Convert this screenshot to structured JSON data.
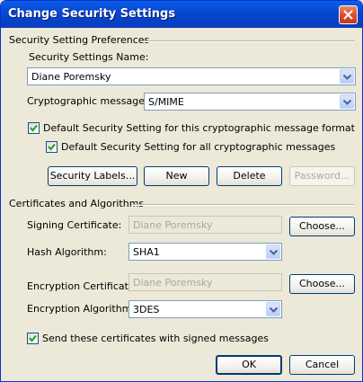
{
  "window": {
    "title": "Change Security Settings"
  },
  "preferences": {
    "section_label": "Security Setting Preferences",
    "name_label": "Security Settings Name:",
    "name_value": "Diane Poremsky",
    "crypto_label": "Cryptographic message",
    "crypto_value": "S/MIME",
    "default_format_label": "Default Security Setting for this cryptographic message format",
    "default_format_checked": true,
    "default_all_label": "Default Security Setting for all cryptographic messages",
    "default_all_checked": true,
    "buttons": {
      "security_labels": "Security Labels...",
      "new": "New",
      "delete": "Delete",
      "password": "Password..."
    }
  },
  "certificates": {
    "section_label": "Certificates and Algorithms",
    "signing_label": "Signing Certificate:",
    "signing_value": "Diane Poremsky",
    "signing_choose": "Choose...",
    "hash_label": "Hash Algorithm:",
    "hash_value": "SHA1",
    "encryption_label": "Encryption Certificate:",
    "encryption_value": "Diane Poremsky",
    "encryption_choose": "Choose...",
    "enc_alg_label": "Encryption Algorithm:",
    "enc_alg_value": "3DES",
    "send_certs_label": "Send these certificates with signed messages",
    "send_certs_checked": true
  },
  "footer": {
    "ok": "OK",
    "cancel": "Cancel"
  },
  "colors": {
    "titlebar": "#0a5fe6",
    "dialog_bg": "#ece9d8",
    "checkmark": "#21a121"
  }
}
